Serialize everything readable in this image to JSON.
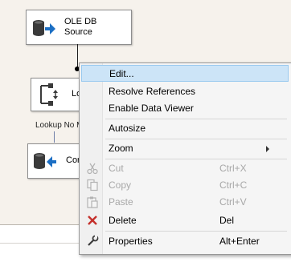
{
  "nodes": {
    "source": {
      "line1": "OLE DB",
      "line2": "Source"
    },
    "lookup": {
      "label": "Lo"
    },
    "dest": {
      "label": "Cor"
    }
  },
  "annotations": {
    "lookup_no_match": "Lookup No M"
  },
  "menu": {
    "edit": "Edit...",
    "resolve": "Resolve References",
    "viewer": "Enable Data Viewer",
    "autosize": "Autosize",
    "zoom": "Zoom",
    "cut": "Cut",
    "cut_sc": "Ctrl+X",
    "copy": "Copy",
    "copy_sc": "Ctrl+C",
    "paste": "Paste",
    "paste_sc": "Ctrl+V",
    "delete": "Delete",
    "delete_sc": "Del",
    "properties": "Properties",
    "properties_sc": "Alt+Enter"
  }
}
